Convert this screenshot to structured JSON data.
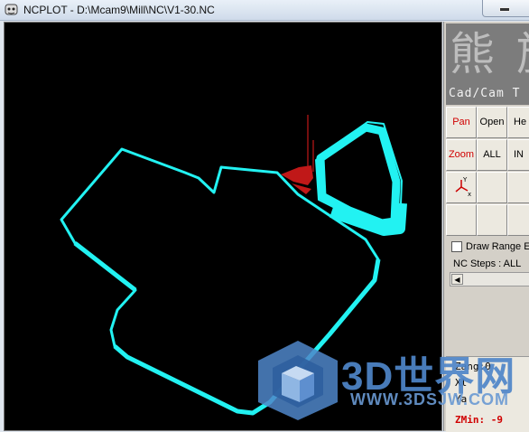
{
  "window": {
    "title": "NCPLOT - D:\\Mcam9\\Mill\\NC\\V1-30.NC",
    "minimize_symbol": "—"
  },
  "sidebar": {
    "logo": {
      "chars": "熊 族",
      "subtitle": "Cad/Cam T"
    },
    "buttons": [
      {
        "label": "Pan",
        "color": "#d00000"
      },
      {
        "label": "Open",
        "color": "#000000"
      },
      {
        "label": "He",
        "color": "#000000"
      },
      {
        "label": "Zoom",
        "color": "#d00000"
      },
      {
        "label": "ALL",
        "color": "#000000"
      },
      {
        "label": "IN",
        "color": "#000000"
      },
      {
        "label": "",
        "icon": "axis-icon"
      },
      {
        "label": ""
      },
      {
        "label": ""
      },
      {
        "label": ""
      },
      {
        "label": ""
      },
      {
        "label": ""
      }
    ],
    "draw_range_label": "Draw Range E",
    "draw_range_checked": false,
    "nc_steps_label": "NC Steps : ALL",
    "readout": {
      "line1": "Zang:0",
      "line2": "Xl",
      "line3": "Ya",
      "zmin": "ZMin:   -9"
    }
  },
  "plot": {
    "background": "#000000",
    "toolpath_color": "#22f2f2",
    "tool_color": "#c01818"
  },
  "watermark": {
    "text": "3D世界网",
    "url": "WWW.3DSJW.COM",
    "color": "#4f86c9"
  }
}
